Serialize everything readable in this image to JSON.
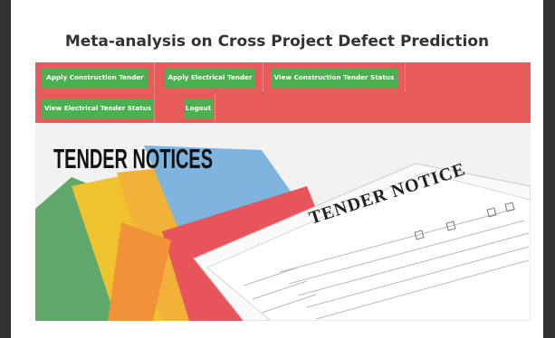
{
  "page": {
    "title": "Meta-analysis on Cross Project Defect Prediction"
  },
  "nav": {
    "items": [
      {
        "label": "Apply Construction Tender"
      },
      {
        "label": "Apply Electrical Tender"
      },
      {
        "label": "View Construction Tender Status"
      },
      {
        "label": "View Electrical Tender Status"
      },
      {
        "label": "Logout"
      }
    ]
  },
  "banner": {
    "heading": "TENDER NOTICES",
    "paper_title": "TENDER NOTICE"
  },
  "colors": {
    "nav_bg": "#e85b5b",
    "button_bg": "#4caf50",
    "frame": "#2f3133"
  }
}
